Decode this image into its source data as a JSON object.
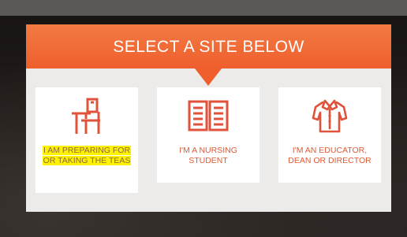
{
  "modal": {
    "title": "SELECT A SITE BELOW"
  },
  "cards": [
    {
      "label": "I AM PREPARING FOR OR TAKING THE TEAS",
      "icon": "desk-chair-icon",
      "highlighted": true
    },
    {
      "label": "I'M A NURSING STUDENT",
      "icon": "open-book-icon",
      "highlighted": false
    },
    {
      "label": "I'M AN EDUCATOR, DEAN OR DIRECTOR",
      "icon": "blouse-icon",
      "highlighted": false
    }
  ],
  "colors": {
    "header": "#ef5f2d",
    "icon": "#e0523a",
    "highlight": "#fff200"
  }
}
